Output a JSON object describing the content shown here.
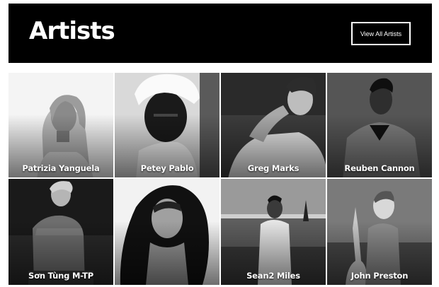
{
  "header": {
    "title": "Artists",
    "view_all_label": "View All Artists"
  },
  "artists": [
    {
      "name": "Patrizia Yanguela",
      "photo": "portrait-photo"
    },
    {
      "name": "Petey Pablo",
      "photo": "portrait-photo"
    },
    {
      "name": "Greg Marks",
      "photo": "portrait-photo"
    },
    {
      "name": "Reuben Cannon",
      "photo": "portrait-photo"
    },
    {
      "name": "Sơn Tùng M-TP",
      "photo": "portrait-photo"
    },
    {
      "name": "",
      "photo": "portrait-photo"
    },
    {
      "name": "Sean2 Miles",
      "photo": "portrait-photo"
    },
    {
      "name": "John Preston",
      "photo": "portrait-photo"
    }
  ],
  "colors": {
    "header_bg": "#000000",
    "text": "#ffffff",
    "page_bg": "#ffffff"
  }
}
